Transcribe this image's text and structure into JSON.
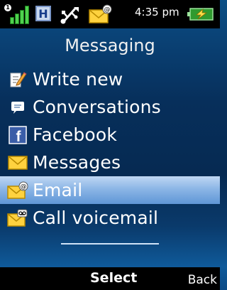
{
  "status_bar": {
    "sim_label": "1",
    "network_type": "H",
    "time": "4:35 pm",
    "icons": [
      "signal-bars-icon",
      "hsdpa-icon",
      "usb-icon",
      "new-email-icon",
      "battery-charging-icon"
    ]
  },
  "header": {
    "title": "Messaging"
  },
  "menu": {
    "items": [
      {
        "label": "Write new",
        "icon": "write-new-icon",
        "selected": false
      },
      {
        "label": "Conversations",
        "icon": "conversations-icon",
        "selected": false
      },
      {
        "label": "Facebook",
        "icon": "facebook-icon",
        "selected": false
      },
      {
        "label": "Messages",
        "icon": "messages-icon",
        "selected": false
      },
      {
        "label": "Email",
        "icon": "email-icon",
        "selected": true
      },
      {
        "label": "Call voicemail",
        "icon": "voicemail-icon",
        "selected": false
      }
    ]
  },
  "softkeys": {
    "center": "Select",
    "right": "Back"
  },
  "colors": {
    "selection": "#8cb6e6",
    "background": "#072f5b",
    "signal_green": "#4fd24f"
  }
}
